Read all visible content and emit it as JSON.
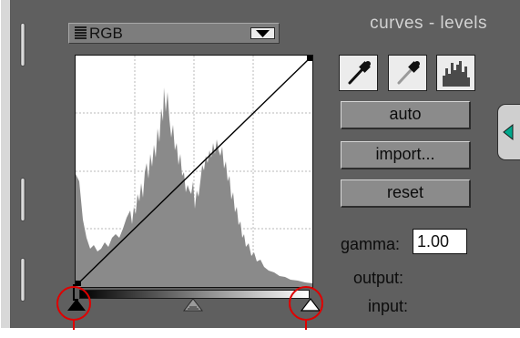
{
  "panel": {
    "title": "curves - levels"
  },
  "channel": {
    "value": "RGB"
  },
  "tools": [
    {
      "icon": "black-point-eyedropper-icon"
    },
    {
      "icon": "white-point-eyedropper-icon"
    },
    {
      "icon": "histogram-icon"
    }
  ],
  "buttons": {
    "auto": "auto",
    "import": "import...",
    "reset": "reset"
  },
  "gamma": {
    "label": "gamma:",
    "value": "1.00"
  },
  "readouts": {
    "output": "output:",
    "input": "input:"
  },
  "colors": {
    "panel": "#5f5f5f",
    "button": "#8b8b8b",
    "histogram": "#8a8a8a",
    "accent": "#00a88c",
    "marker": "#e00000"
  },
  "histogram": {
    "shape": "smoothed luminance histogram, peaks near 35% and 60% of input range",
    "peak_positions": [
      0.38,
      0.62
    ]
  }
}
